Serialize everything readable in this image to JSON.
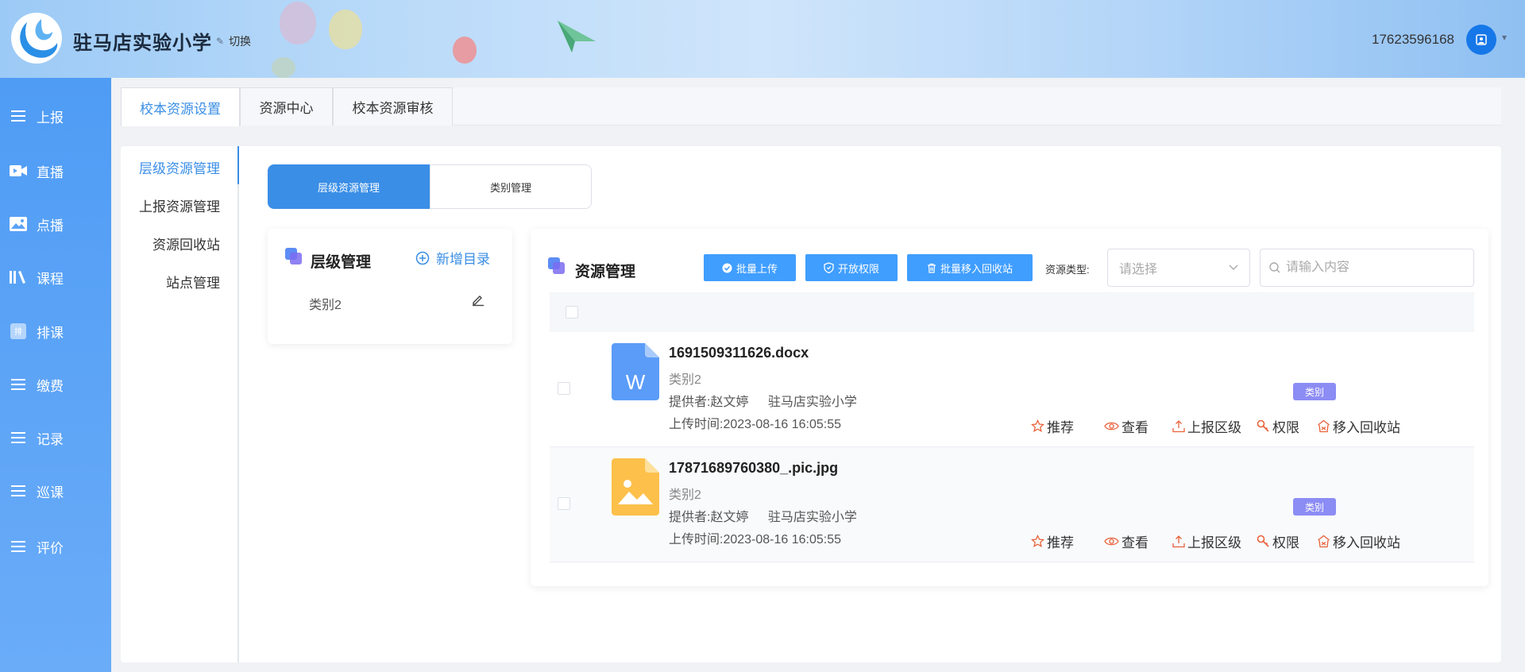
{
  "header": {
    "school_name": "驻马店实验小学",
    "switch_label": "切换",
    "phone": "17623596168"
  },
  "sidebar": {
    "items": [
      {
        "label": "上报",
        "icon": "menu-icon"
      },
      {
        "label": "直播",
        "icon": "video-icon"
      },
      {
        "label": "点播",
        "icon": "image-icon"
      },
      {
        "label": "课程",
        "icon": "books-icon"
      },
      {
        "label": "排课",
        "icon": "schedule-icon"
      },
      {
        "label": "缴费",
        "icon": "menu-icon"
      },
      {
        "label": "记录",
        "icon": "menu-icon"
      },
      {
        "label": "巡课",
        "icon": "menu-icon"
      },
      {
        "label": "评价",
        "icon": "menu-icon"
      }
    ]
  },
  "tabs": [
    {
      "label": "校本资源设置",
      "active": true
    },
    {
      "label": "资源中心",
      "active": false
    },
    {
      "label": "校本资源审核",
      "active": false
    }
  ],
  "sub_nav": [
    {
      "label": "层级资源管理",
      "active": true
    },
    {
      "label": "上报资源管理",
      "active": false
    },
    {
      "label": "资源回收站",
      "active": false
    },
    {
      "label": "站点管理",
      "active": false
    }
  ],
  "segments": [
    {
      "label": "层级资源管理",
      "active": true
    },
    {
      "label": "类别管理",
      "active": false
    }
  ],
  "hierarchy_panel": {
    "title": "层级管理",
    "add_label": "新增目录",
    "categories": [
      "类别2"
    ]
  },
  "resource_panel": {
    "title": "资源管理",
    "buttons": {
      "batch_upload": "批量上传",
      "open_permission": "开放权限",
      "batch_recycle": "批量移入回收站"
    },
    "type_label": "资源类型:",
    "type_placeholder": "请选择",
    "search_placeholder": "请输入内容",
    "rows": [
      {
        "file_name": "1691509311626.docx",
        "file_type": "word",
        "category": "类别2",
        "provider": "提供者:赵文婷",
        "school": "驻马店实验小学",
        "upload_time": "上传时间:2023-08-16 16:05:55",
        "badge": "类别"
      },
      {
        "file_name": "17871689760380_.pic.jpg",
        "file_type": "image",
        "category": "类别2",
        "provider": "提供者:赵文婷",
        "school": "驻马店实验小学",
        "upload_time": "上传时间:2023-08-16 16:05:55",
        "badge": "类别"
      }
    ],
    "actions": {
      "recommend": "推荐",
      "view": "查看",
      "report_up": "上报区级",
      "permission": "权限",
      "recycle": "移入回收站"
    }
  },
  "colors": {
    "primary": "#409eff",
    "accent_action": "#e8623a",
    "badge": "#8c8cf5",
    "sidebar": "#5ba3f6"
  }
}
